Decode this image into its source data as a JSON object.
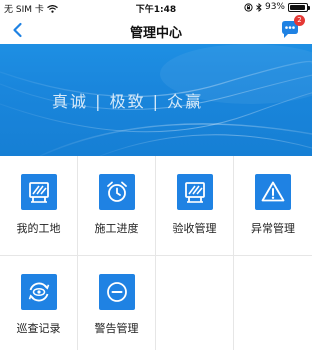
{
  "status_bar": {
    "carrier": "无 SIM 卡",
    "time": "下午1:48",
    "battery": "93%",
    "battery_level": 0.93
  },
  "nav": {
    "title": "管理中心",
    "badge_count": "2",
    "back_icon": "chevron-left-icon",
    "message_icon": "chat-bubble-icon"
  },
  "banner": {
    "text": "真诚 | 极致 | 众赢"
  },
  "menu": [
    {
      "label": "我的工地",
      "icon": "construction-barrier-icon"
    },
    {
      "label": "施工进度",
      "icon": "alarm-clock-icon"
    },
    {
      "label": "验收管理",
      "icon": "construction-barrier-icon"
    },
    {
      "label": "异常管理",
      "icon": "warning-icon"
    },
    {
      "label": "巡查记录",
      "icon": "eye-refresh-icon"
    },
    {
      "label": "警告管理",
      "icon": "minus-circle-icon"
    }
  ],
  "colors": {
    "accent": "#1f82e3",
    "banner": "#1a86dc",
    "badge": "#e53935"
  }
}
